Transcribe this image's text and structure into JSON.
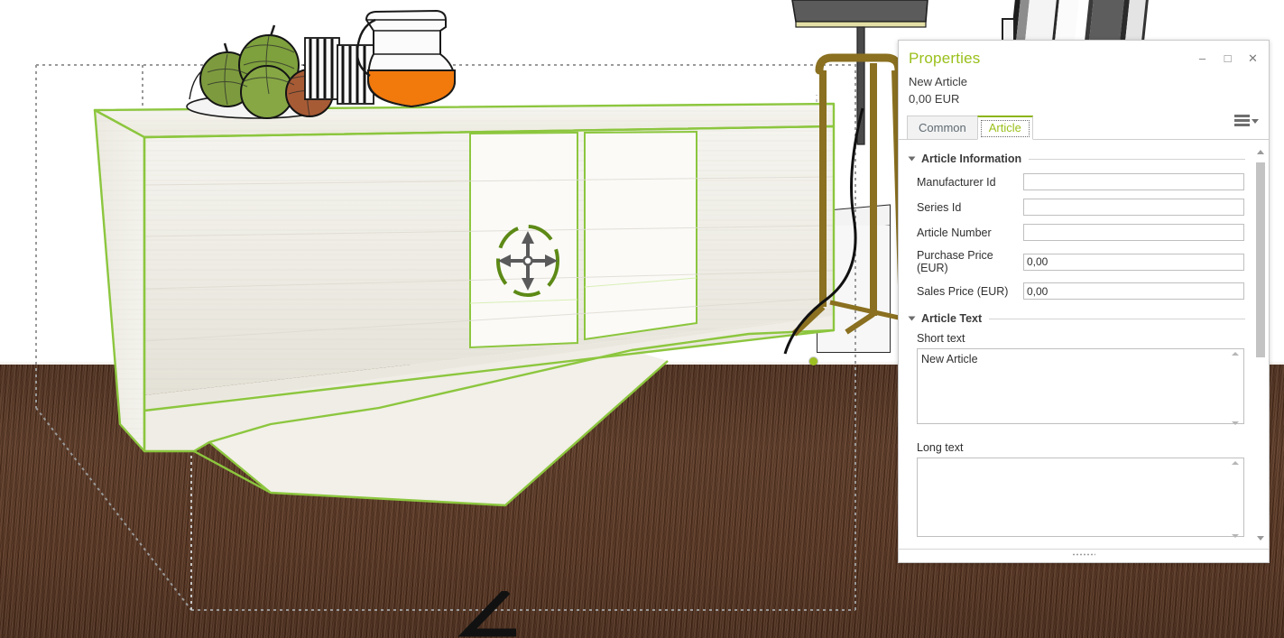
{
  "app": {
    "scene_description": "3D interior room view with selected sideboard cabinet",
    "selection_color": "#8CC63E",
    "floor_color": "#55311D",
    "accent_green": "#9AC01B"
  },
  "panel": {
    "title": "Properties",
    "article_name": "New Article",
    "price": "0,00 EUR",
    "window_controls": {
      "minimize": "–",
      "maximize": "□",
      "close": "✕"
    },
    "menu_icon": "hamburger-menu-icon",
    "tabs": [
      {
        "label": "Common",
        "active": false
      },
      {
        "label": "Article",
        "active": true
      }
    ],
    "sections": [
      {
        "title": "Article Information",
        "fields": [
          {
            "label": "Manufacturer Id",
            "value": ""
          },
          {
            "label": "Series Id",
            "value": ""
          },
          {
            "label": "Article Number",
            "value": ""
          },
          {
            "label": "Purchase Price (EUR)",
            "value": "0,00"
          },
          {
            "label": "Sales Price (EUR)",
            "value": "0,00"
          }
        ]
      },
      {
        "title": "Article Text",
        "short_text_label": "Short text",
        "short_text_value": "New Article",
        "long_text_label": "Long text",
        "long_text_value": ""
      }
    ]
  },
  "viewport": {
    "objects": [
      "sideboard-cabinet",
      "fruit-bowl",
      "drinking-glasses",
      "juice-pitcher",
      "tripod-floor-lamp",
      "move-gizmo",
      "selection-bounding-box"
    ]
  }
}
